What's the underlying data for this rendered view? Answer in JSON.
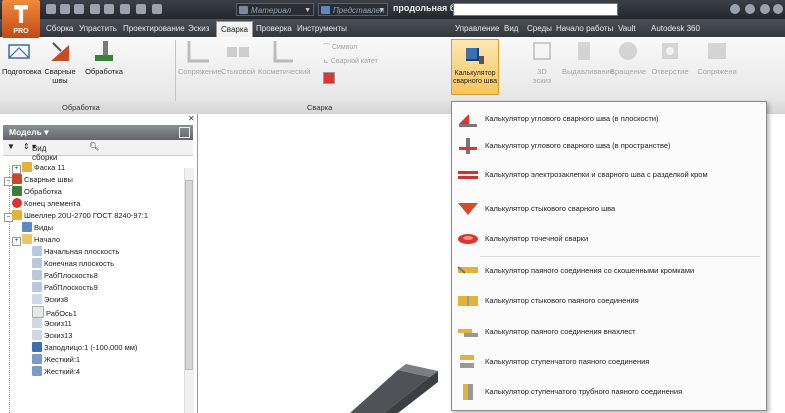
{
  "titlebar": {
    "app_label": "PRO",
    "combo_material": "Материал",
    "combo_preset": "Представлен",
    "doc_title": "продольная б..."
  },
  "tabs": [
    {
      "label": "Сборка"
    },
    {
      "label": "Упрастить"
    },
    {
      "label": "Проектирование"
    },
    {
      "label": "Эскиз"
    },
    {
      "label": "Сварка"
    },
    {
      "label": "Проверка"
    },
    {
      "label": "Инструменты"
    },
    {
      "label": "Управление"
    },
    {
      "label": "Вид"
    },
    {
      "label": "Среды"
    },
    {
      "label": "Начало работы"
    },
    {
      "label": "Vault"
    },
    {
      "label": "Autodesk 360"
    }
  ],
  "ribbon": {
    "prep_label": "Подготовка",
    "welds_label": "Сварные швы",
    "machining_label": "Обработка",
    "fillet_label": "Сопряжение",
    "groove_label": "Стыковой",
    "cosmetic_label": "Косметический",
    "symbol_label": "Символ",
    "weld_cat_label": "Сварной катет",
    "calc_label_line1": "Калькулятор",
    "calc_label_line2": "сварного шва",
    "sketch3d_label": "3D эскиз",
    "extrude_label": "Выдавливание",
    "revolve_label": "Вращение",
    "hole_label": "Отверстие",
    "fillet2_label": "Сопряжени",
    "group_machining": "Обработка",
    "group_weld": "Сварка"
  },
  "browser": {
    "header": "Модель",
    "view_label": "Вид сборки",
    "items": [
      {
        "label": "Фаска 11"
      },
      {
        "label": "Сварные швы"
      },
      {
        "label": "Обработка"
      },
      {
        "label": "Конец элемента"
      },
      {
        "label": "Швеллер 20U-2700 ГОСТ 8240-97:1"
      },
      {
        "label": "Виды"
      },
      {
        "label": "Начало"
      },
      {
        "label": "Начальная плоскость"
      },
      {
        "label": "Конечная плоскость"
      },
      {
        "label": "РабПлоскость8"
      },
      {
        "label": "РабПлоскость9"
      },
      {
        "label": "Эскиз8"
      },
      {
        "label": "РабОсь1"
      },
      {
        "label": "Эскиз11"
      },
      {
        "label": "Эскиз13"
      },
      {
        "label": "Заподлицо:1 (-100,000 мм)"
      },
      {
        "label": "Жесткий:1"
      },
      {
        "label": "Жесткий:4"
      }
    ]
  },
  "menu": {
    "items": [
      {
        "label": "Калькулятор углового сварного шва (в плоскости)"
      },
      {
        "label": "Калькулятор углового сварного шва (в пространстве)"
      },
      {
        "label": "Калькулятор электрозаклепки и сварного шва с разделкой кром"
      },
      {
        "label": "Калькулятор стыкового сварного шва"
      },
      {
        "label": "Калькулятор точечной сварки"
      },
      {
        "label": "Калькулятор паяного соединения со скошенными кромками"
      },
      {
        "label": "Калькулятор стыкового паяного соединения"
      },
      {
        "label": "Калькулятор паяного соединения внахлест"
      },
      {
        "label": "Калькулятор ступенчатого паяного соединения"
      },
      {
        "label": "Калькулятор ступенчатого трубного паяного соединения"
      }
    ]
  },
  "colors": {
    "accent": "#f08a3c",
    "ribbon_active": "#f6c45a",
    "title_bar": "#2c3036"
  }
}
